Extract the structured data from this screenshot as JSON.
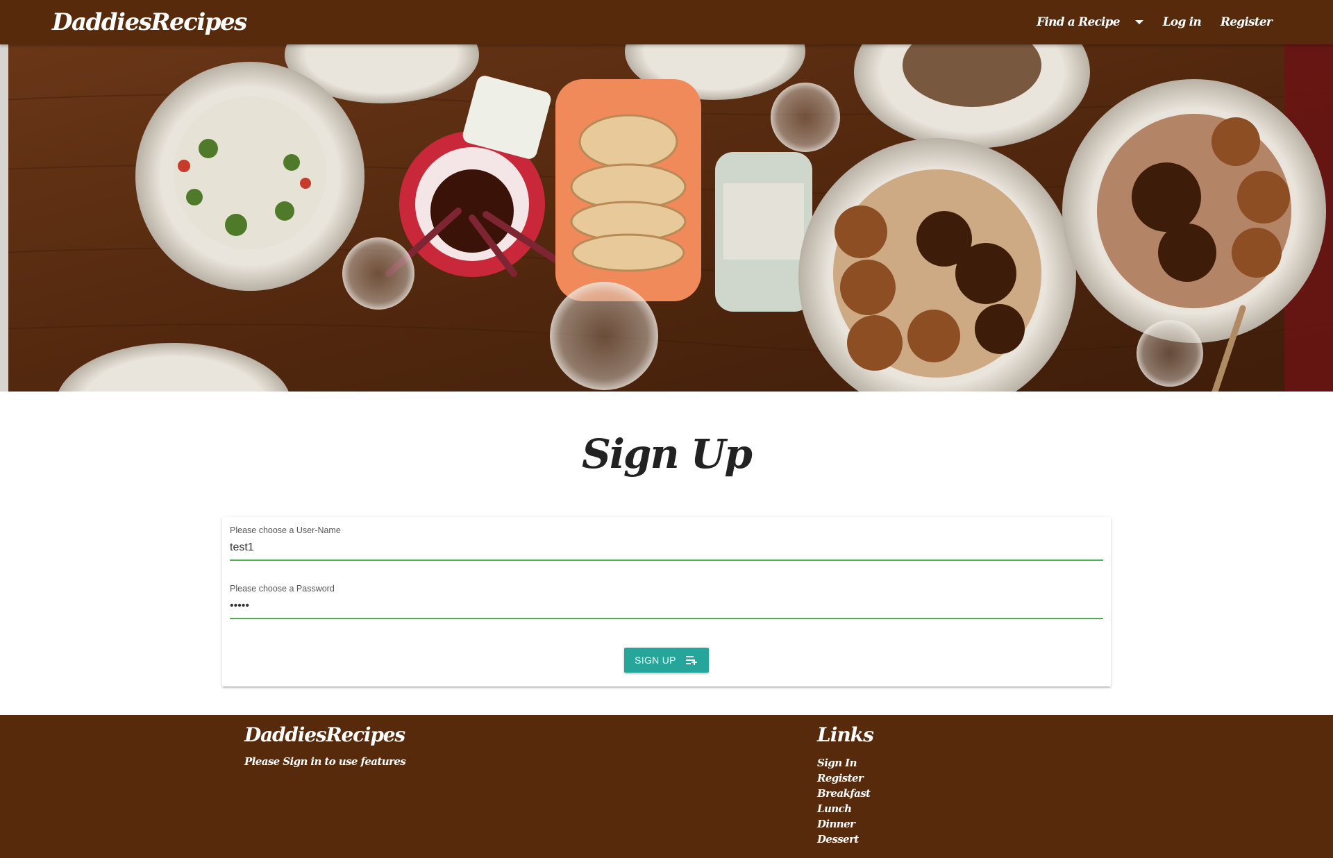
{
  "navbar": {
    "brand": "DaddiesRecipes",
    "links": [
      {
        "label": "Find a Recipe",
        "has_dropdown": true
      },
      {
        "label": "Log in"
      },
      {
        "label": "Register"
      }
    ]
  },
  "hero": {
    "image_description": "overhead table with plates of food, bread basket, glasses"
  },
  "signup": {
    "title": "Sign Up",
    "username": {
      "label": "Please choose a User-Name",
      "value": "test1"
    },
    "password": {
      "label": "Please choose a Password",
      "value": "•••••"
    },
    "button": {
      "label": "SIGN UP",
      "icon": "playlist-add-icon"
    }
  },
  "footer": {
    "brand": "DaddiesRecipes",
    "text": "Please Sign in to use features",
    "links_title": "Links",
    "links": [
      "Sign In",
      "Register",
      "Breakfast",
      "Lunch",
      "Dinner",
      "Dessert"
    ]
  },
  "colors": {
    "brand_brown": "#572a0c",
    "accent_teal": "#26a69a",
    "input_underline": "#4caf50"
  }
}
